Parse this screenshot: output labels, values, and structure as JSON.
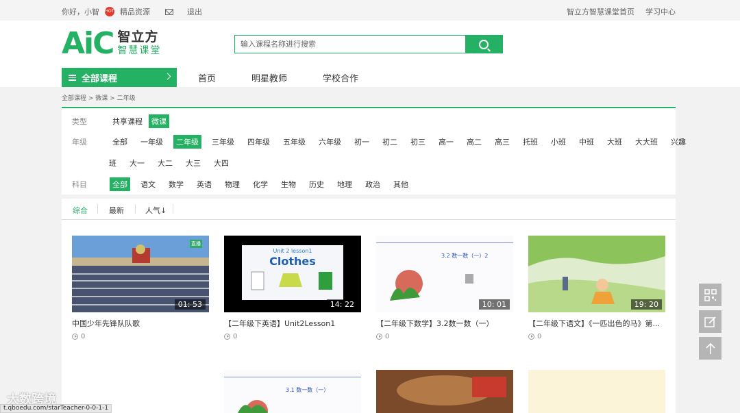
{
  "topbar": {
    "greeting": "你好，小智",
    "premium": "精品资源",
    "hot_badge": "HOT",
    "logout": "退出",
    "home_link": "智立方智慧课堂首页",
    "study_center": "学习中心"
  },
  "logo": {
    "mark": "AiC",
    "name_top": "智立方",
    "name_bottom": "智慧课堂"
  },
  "search": {
    "placeholder": "输入课程名称进行搜索"
  },
  "all_courses": "全部课程",
  "nav": [
    "首页",
    "明星教师",
    "学校合作"
  ],
  "breadcrumb": [
    "全部课程",
    "微课",
    "二年级"
  ],
  "filters": {
    "type": {
      "label": "类型",
      "options": [
        "共享课程",
        "微课"
      ],
      "selected": "微课"
    },
    "grade": {
      "label": "年级",
      "options_line1": [
        "全部",
        "一年级",
        "二年级",
        "三年级",
        "四年级",
        "五年级",
        "六年级",
        "初一",
        "初二",
        "初三",
        "高一",
        "高二",
        "高三",
        "托班",
        "小班",
        "中班",
        "大班",
        "大大班",
        "兴趣"
      ],
      "options_line2": [
        "班",
        "大一",
        "大二",
        "大三",
        "大四"
      ],
      "selected": "二年级"
    },
    "subject": {
      "label": "科目",
      "options": [
        "全部",
        "语文",
        "数学",
        "英语",
        "物理",
        "化学",
        "生物",
        "历史",
        "地理",
        "政治",
        "其他"
      ],
      "selected": "全部"
    }
  },
  "sort": {
    "tabs": [
      "综合",
      "最新",
      "人气↓"
    ],
    "active": "综合"
  },
  "courses": [
    {
      "title": "中国少年先锋队队歌",
      "duration": "01: 53",
      "views": "0",
      "badge": "直播"
    },
    {
      "title": "【二年级下英语】Unit2Lesson1",
      "duration": "14: 22",
      "views": "0",
      "lesson_label": "Unit 2  lesson1",
      "lesson_word": "Clothes"
    },
    {
      "title": "【二年级下数学】3.2数一数（一）",
      "duration": "10: 01",
      "views": "0",
      "slide_text": "3.2  数一数（一）2"
    },
    {
      "title": "【二年级下语文】《一匹出色的马》第...",
      "duration": "19: 20",
      "views": "0"
    }
  ],
  "row2": {
    "slide_text": "3.1  数一数（一）"
  },
  "watermark": "大数跨境",
  "status_url": "t.qboedu.com/starTeacher-0-0-1-1",
  "colors": {
    "accent": "#25b164"
  }
}
